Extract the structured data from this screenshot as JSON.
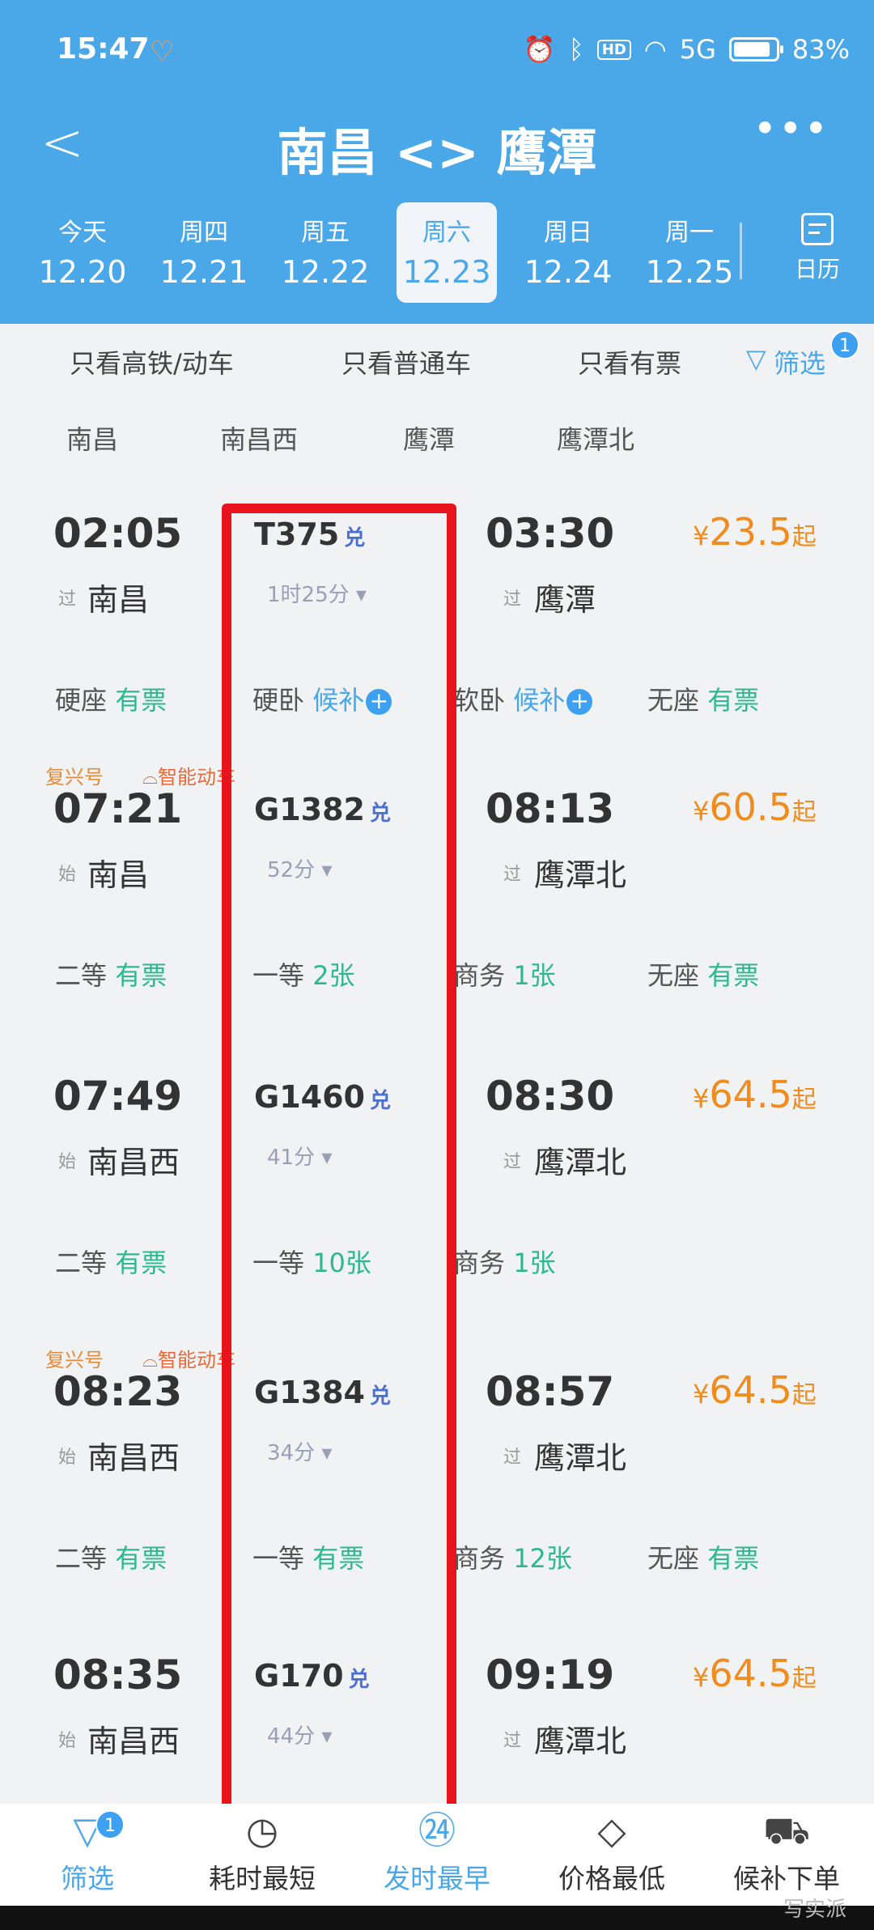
{
  "status": {
    "time": "15:47",
    "net": "5G",
    "battery": "83%"
  },
  "nav": {
    "back": "<",
    "title": "南昌 <> 鹰潭",
    "more": "•••"
  },
  "dates": [
    {
      "day": "今天",
      "date": "12.20"
    },
    {
      "day": "周四",
      "date": "12.21"
    },
    {
      "day": "周五",
      "date": "12.22"
    },
    {
      "day": "周六",
      "date": "12.23",
      "active": true
    },
    {
      "day": "周日",
      "date": "12.24"
    },
    {
      "day": "周一",
      "date": "12.25"
    }
  ],
  "calendar_label": "日历",
  "filters": {
    "gaotie": "只看高铁/动车",
    "putong": "只看普通车",
    "youpiao": "只看有票",
    "shaixuan": "筛选",
    "badge": "1"
  },
  "stations": [
    "南昌",
    "南昌西",
    "鹰潭",
    "鹰潭北"
  ],
  "trains": [
    {
      "tag1": "",
      "tag2": "",
      "dep": "02:05",
      "dep_via": "过",
      "dep_stn": "南昌",
      "no": "T375",
      "dui": "兑",
      "dur": "1时25分 ▾",
      "arr": "03:30",
      "arr_via": "过",
      "arr_stn": "鹰潭",
      "price_y": "¥",
      "price": "23.5",
      "price_q": "起",
      "seats": [
        {
          "name": "硬座",
          "status": "有票",
          "kind": "g"
        },
        {
          "name": "硬卧",
          "status": "候补",
          "kind": "b",
          "plus": true
        },
        {
          "name": "软卧",
          "status": "候补",
          "kind": "b",
          "plus": true
        },
        {
          "name": "无座",
          "status": "有票",
          "kind": "g"
        }
      ]
    },
    {
      "tag1": "复兴号",
      "tag2": "智能动车",
      "dep": "07:21",
      "dep_via": "始",
      "dep_stn": "南昌",
      "no": "G1382",
      "dui": "兑",
      "dur": "52分 ▾",
      "arr": "08:13",
      "arr_via": "过",
      "arr_stn": "鹰潭北",
      "price_y": "¥",
      "price": "60.5",
      "price_q": "起",
      "seats": [
        {
          "name": "二等",
          "status": "有票",
          "kind": "g"
        },
        {
          "name": "一等",
          "status": "2张",
          "kind": "g"
        },
        {
          "name": "商务",
          "status": "1张",
          "kind": "g"
        },
        {
          "name": "无座",
          "status": "有票",
          "kind": "g"
        }
      ]
    },
    {
      "tag1": "",
      "tag2": "",
      "dep": "07:49",
      "dep_via": "始",
      "dep_stn": "南昌西",
      "no": "G1460",
      "dui": "兑",
      "dur": "41分 ▾",
      "arr": "08:30",
      "arr_via": "过",
      "arr_stn": "鹰潭北",
      "price_y": "¥",
      "price": "64.5",
      "price_q": "起",
      "seats": [
        {
          "name": "二等",
          "status": "有票",
          "kind": "g"
        },
        {
          "name": "一等",
          "status": "10张",
          "kind": "g"
        },
        {
          "name": "商务",
          "status": "1张",
          "kind": "g"
        }
      ]
    },
    {
      "tag1": "复兴号",
      "tag2": "智能动车",
      "dep": "08:23",
      "dep_via": "始",
      "dep_stn": "南昌西",
      "no": "G1384",
      "dui": "兑",
      "dur": "34分 ▾",
      "arr": "08:57",
      "arr_via": "过",
      "arr_stn": "鹰潭北",
      "price_y": "¥",
      "price": "64.5",
      "price_q": "起",
      "seats": [
        {
          "name": "二等",
          "status": "有票",
          "kind": "g"
        },
        {
          "name": "一等",
          "status": "有票",
          "kind": "g"
        },
        {
          "name": "商务",
          "status": "12张",
          "kind": "g"
        },
        {
          "name": "无座",
          "status": "有票",
          "kind": "g"
        }
      ]
    },
    {
      "tag1": "",
      "tag2": "",
      "dep": "08:35",
      "dep_via": "始",
      "dep_stn": "南昌西",
      "no": "G170",
      "dui": "兑",
      "dur": "44分 ▾",
      "arr": "09:19",
      "arr_via": "过",
      "arr_stn": "鹰潭北",
      "price_y": "¥",
      "price": "64.5",
      "price_q": "起",
      "seats": []
    }
  ],
  "tabs": [
    {
      "label": "筛选",
      "icon": "filter-icon",
      "glyph": "▽",
      "badge": "1",
      "blue": true
    },
    {
      "label": "耗时最短",
      "icon": "timer-icon",
      "glyph": "◷",
      "blue": false
    },
    {
      "label": "发时最早",
      "icon": "clock-24-icon",
      "glyph": "㉔",
      "blue": true
    },
    {
      "label": "价格最低",
      "icon": "price-tag-icon",
      "glyph": "◇",
      "blue": false
    },
    {
      "label": "候补下单",
      "icon": "cart-icon",
      "glyph": "⛟",
      "blue": false
    }
  ],
  "watermark": "写实派"
}
